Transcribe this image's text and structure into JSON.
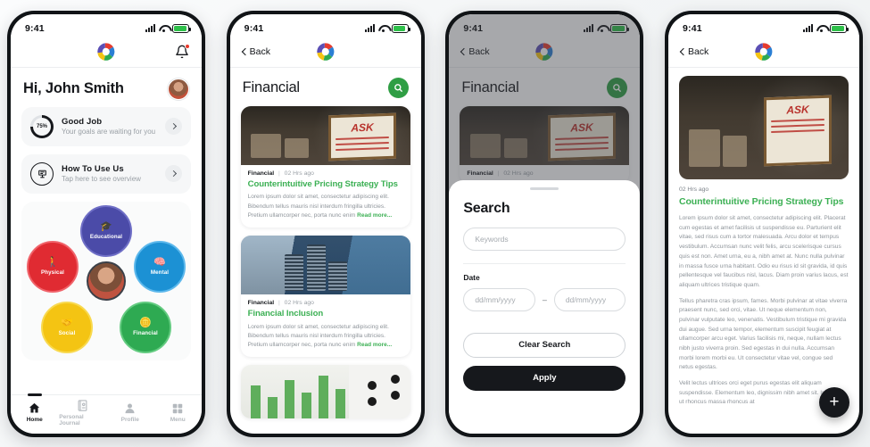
{
  "statusbar": {
    "time": "9:41"
  },
  "brand": {
    "logo_icon": "shutter-logo-icon",
    "accent_green": "#3cb054",
    "fab_green": "#2f9e44",
    "dark": "#16181c"
  },
  "screen1": {
    "name": "home",
    "notification_icon": "bell-icon",
    "greeting": "Hi, John Smith",
    "avatar": "user-avatar",
    "cards": [
      {
        "icon": "progress-ring-icon",
        "progress": "75%",
        "title": "Good Job",
        "subtitle": "Your goals are waiting for you",
        "chevron": "chevron-right-icon"
      },
      {
        "icon": "guide-icon",
        "title": "How To Use Us",
        "subtitle": "Tap here to see overview",
        "chevron": "chevron-right-icon"
      }
    ],
    "wheel": [
      {
        "label": "Educational",
        "color": "#4b4ba8",
        "glyph": "🎓",
        "icon_name": "graduation-cap-icon"
      },
      {
        "label": "Physical",
        "color": "#e02b32",
        "glyph": "🚶",
        "icon_name": "walking-person-icon"
      },
      {
        "label": "Mental",
        "color": "#1c91d4",
        "glyph": "🧠",
        "icon_name": "brain-icon"
      },
      {
        "label": "Social",
        "color": "#f4c413",
        "glyph": "🤝",
        "icon_name": "handshake-icon"
      },
      {
        "label": "Financial",
        "color": "#2eaa52",
        "glyph": "🪙",
        "icon_name": "coins-icon"
      }
    ],
    "tabs": [
      {
        "label": "Home",
        "icon": "home-icon",
        "active": true
      },
      {
        "label": "Personal Journal",
        "icon": "journal-icon",
        "active": false
      },
      {
        "label": "Profile",
        "icon": "profile-icon",
        "active": false
      },
      {
        "label": "Menu",
        "icon": "grid-menu-icon",
        "active": false
      }
    ]
  },
  "screen2": {
    "name": "financial-list",
    "back_label": "Back",
    "title": "Financial",
    "search_icon": "search-icon",
    "articles": [
      {
        "category": "Financial",
        "separator": "|",
        "ago": "02 Hrs ago",
        "title": "Counterintuitive Pricing Strategy Tips",
        "excerpt": "Lorem ipsum dolor sit amet, consectetur adipiscing elit. Bibendum tellus mauris nisl interdum fringilla ultricies. Pretium ullamcorper nec, porta nunc enim ",
        "read_more": "Read more...",
        "image": "cafe-chalkboard-photo"
      },
      {
        "category": "Financial",
        "separator": "|",
        "ago": "02 Hrs ago",
        "title": "Financial Inclusion",
        "excerpt": "Lorem ipsum dolor sit amet, consectetur adipiscing elit. Bibendum tellus mauris nisl interdum fringilla ultricies. Pretium ullamcorper nec, porta nunc enim ",
        "read_more": "Read more...",
        "image": "coin-stacks-city-photo"
      },
      {
        "image": "bar-chart-calculator-photo"
      }
    ]
  },
  "screen3": {
    "name": "search-modal",
    "back_label": "Back",
    "title": "Financial",
    "search_icon": "search-icon",
    "behind_article": {
      "category": "Financial",
      "separator": "|",
      "ago": "02 Hrs ago",
      "image": "cafe-chalkboard-photo"
    },
    "sheet": {
      "heading": "Search",
      "keywords_placeholder": "Keywords",
      "date_label": "Date",
      "date_from_placeholder": "dd/mm/yyyy",
      "date_to_placeholder": "dd/mm/yyyy",
      "range_separator": "–",
      "clear_label": "Clear Search",
      "apply_label": "Apply"
    }
  },
  "screen4": {
    "name": "article-detail",
    "back_label": "Back",
    "image": "cafe-chalkboard-photo",
    "ago": "02 Hrs ago",
    "title": "Counterintuitive Pricing Strategy Tips",
    "paragraphs": [
      "Lorem ipsum dolor sit amet, consectetur adipiscing elit. Placerat cum egestas et amet facilisis ut suspendisse eu. Parturient elit vitae, sed risus cum a tortor malesuada. Arcu dolor et tempus vestibulum. Accumsan nunc velit felis, arcu scelerisque cursus quis est non. Amet urna, eu a, nibh amet at. Nunc nulla pulvinar in massa fusce urna habitant. Odio eu risus id sit gravida, id quis pellentesque vel faucibus nisl, lacus. Diam proin varius lacus, est aliquam ultrices tristique quam.",
      "Tellus pharetra cras ipsum, fames. Morbi pulvinar at vitae viverra praesent nunc, sed orci, vitae. Ut neque elementum non, pulvinar vulputate leo, venenatis. Vestibulum tristique mi gravida dui augue. Sed urna tempor, elementum suscipit feugiat at ullamcorper arcu eget. Varius facilisis mi, neque, nullam lectus nibh justo viverra proin. Sed egestas in dui nulla. Accumsan morbi lorem morbi eu. Ut consectetur vitae vel, congue sed netus egestas.",
      "Velit lectus ultrices orci eget purus egestas elit aliquam suspendisse. Elementum leo, dignissim nibh amet sit. Interdum ut rhoncus massa rhoncus at"
    ],
    "fab_icon": "plus-icon",
    "fab_label": "+"
  }
}
